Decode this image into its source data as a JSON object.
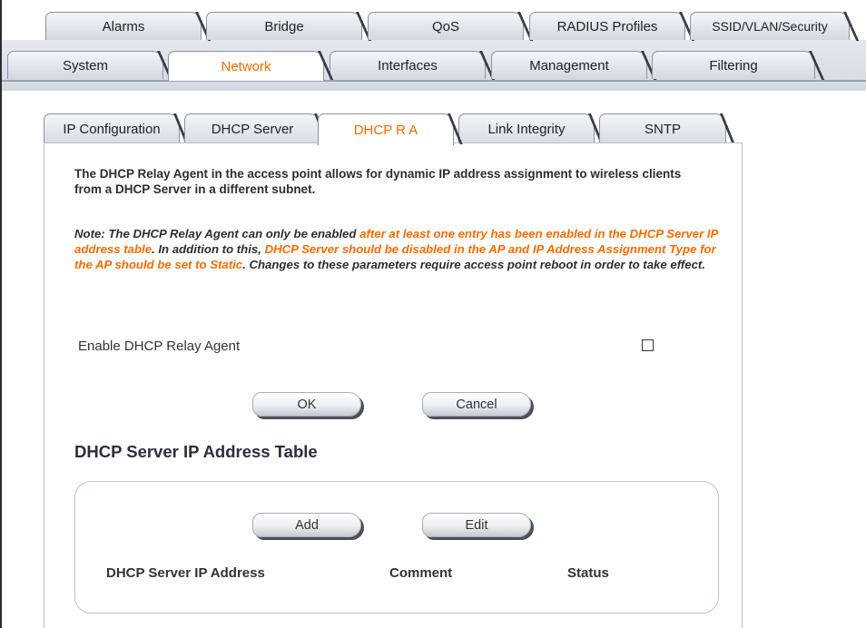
{
  "top_tabs_row1": [
    "Alarms",
    "Bridge",
    "QoS",
    "RADIUS Profiles",
    "SSID/VLAN/Security"
  ],
  "top_tabs_row2": [
    "System",
    "Network",
    "Interfaces",
    "Management",
    "Filtering"
  ],
  "active_top_tab": "Network",
  "sub_tabs": [
    "IP Configuration",
    "DHCP Server",
    "DHCP R A",
    "Link Integrity",
    "SNTP"
  ],
  "active_sub_tab": "DHCP R A",
  "intro_text": "The DHCP Relay Agent in the access point allows for dynamic IP address assignment to wireless clients from a DHCP Server in a different subnet.",
  "note": {
    "part1": "Note: The DHCP Relay Agent can only be enabled ",
    "part2": "after at least one entry has been enabled in the DHCP Server IP address table",
    "part3": ". In addition to this, ",
    "part4": "DHCP Server should be disabled in the AP and IP Address Assignment Type for the AP should be set to Static",
    "part5": ". Changes to these parameters require access point reboot in order to take effect."
  },
  "enable_label": "Enable DHCP Relay Agent",
  "enable_checked": false,
  "buttons": {
    "ok": "OK",
    "cancel": "Cancel",
    "add": "Add",
    "edit": "Edit"
  },
  "table": {
    "title": "DHCP Server IP Address Table",
    "columns": [
      "DHCP Server IP Address",
      "Comment",
      "Status"
    ]
  },
  "colors": {
    "active_tab_text": "#ff6a00",
    "highlight": "#ff6a00"
  }
}
